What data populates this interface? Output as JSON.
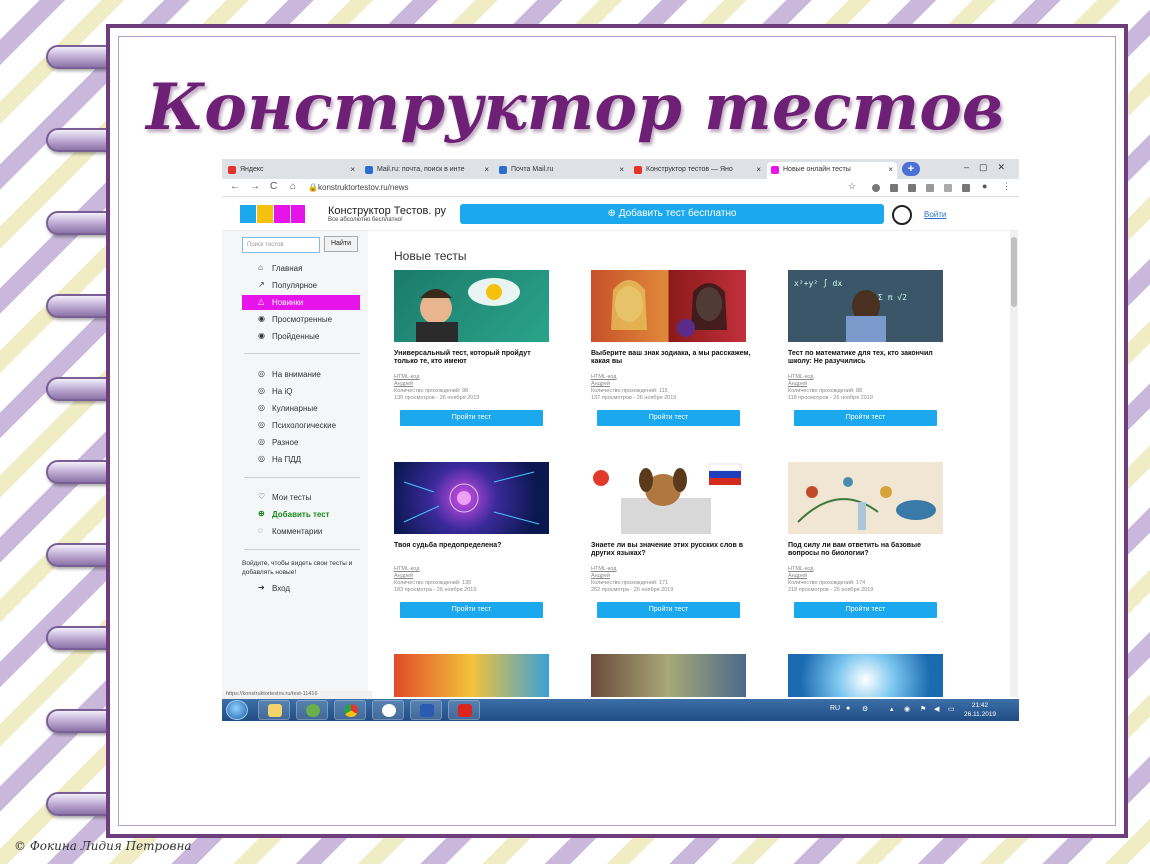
{
  "slide": {
    "title": "Конструктор тестов",
    "copyright": "© Фокина Лидия Петровна"
  },
  "browser": {
    "tabs": [
      {
        "label": "Яндекс",
        "icon": "yandex-icon"
      },
      {
        "label": "Mail.ru: почта, поиск в инте",
        "icon": "mailru-icon"
      },
      {
        "label": "Почта Mail.ru",
        "icon": "mailru-icon"
      },
      {
        "label": "Конструктор тестов — Яно",
        "icon": "yandex-icon"
      },
      {
        "label": "Новые онлайн тесты",
        "icon": "puzzle-icon"
      }
    ],
    "new_tab": "+",
    "close": "×",
    "url": "konstruktortestov.ru/news"
  },
  "site": {
    "name": "Конструктор Тестов. ру",
    "subtitle": "Все абсолютно бесплатно!",
    "add_test_button": "Добавить тест бесплатно",
    "login": "Войти",
    "search_placeholder": "Поиск тестов",
    "search_button": "Найти",
    "menu_main": [
      {
        "label": "Главная",
        "icon": "home-icon"
      },
      {
        "label": "Популярное",
        "icon": "chart-icon"
      },
      {
        "label": "Новинки",
        "icon": "bell-icon"
      },
      {
        "label": "Просмотренные",
        "icon": "eye-icon"
      },
      {
        "label": "Пройденные",
        "icon": "eye-check-icon"
      }
    ],
    "menu_categories": [
      {
        "label": "На внимание"
      },
      {
        "label": "На iQ"
      },
      {
        "label": "Кулинарные"
      },
      {
        "label": "Психологические"
      },
      {
        "label": "Разное"
      },
      {
        "label": "На ПДД"
      }
    ],
    "menu_user": [
      {
        "label": "Мои тесты",
        "icon": "heart-icon"
      },
      {
        "label": "Добавить тест",
        "icon": "plus-circle-icon"
      },
      {
        "label": "Комментарии",
        "icon": "comment-icon"
      }
    ],
    "login_note": "Войдите, чтобы видеть свои тесты и добавлять новые!",
    "login_link": "Вход",
    "section_title": "Новые тесты",
    "take_button": "Пройти тест",
    "cards": [
      {
        "title": "Универсальный тест, который пройдут только те, кто имеют",
        "link": "HTML-код",
        "author": "Андрей",
        "count": "Количество прохождений: 98",
        "views": "130 просмотров - 26 ноября 2019"
      },
      {
        "title": "Выберите ваш знак зодиака, а мы расскажем, какая вы",
        "link": "HTML-код",
        "author": "Андрей",
        "count": "Количество прохождений: 115",
        "views": "137 просмотров - 26 ноября 2019"
      },
      {
        "title": "Тест по математике для тех, кто закончил школу: Не разучились",
        "link": "HTML-код",
        "author": "Андрей",
        "count": "Количество прохождений: 88",
        "views": "118 просмотров - 26 ноября 2019"
      },
      {
        "title": "Твоя судьба предопределена?",
        "link": "HTML-код",
        "author": "Андрей",
        "count": "Количество прохождений: 135",
        "views": "183 просмотра - 26 ноября 2019"
      },
      {
        "title": "Знаете ли вы значение этих русских слов в других языках?",
        "link": "HTML-код",
        "author": "Андрей",
        "count": "Количество прохождений: 171",
        "views": "252 просмотра - 26 ноября 2019"
      },
      {
        "title": "Под силу ли вам ответить на базовые вопросы по биологии?",
        "link": "HTML-код",
        "author": "Андрей",
        "count": "Количество прохождений: 174",
        "views": "218 просмотров - 26 ноября 2019"
      }
    ],
    "status_url": "https://konstruktortestov.ru/test-11416"
  },
  "taskbar": {
    "lang": "RU",
    "time": "21:42",
    "date": "26.11.2019"
  },
  "colors": {
    "accent": "#1ca8ec",
    "active_menu": "#e614e8",
    "title": "#6e1f76",
    "frame": "#6d3d7c"
  }
}
